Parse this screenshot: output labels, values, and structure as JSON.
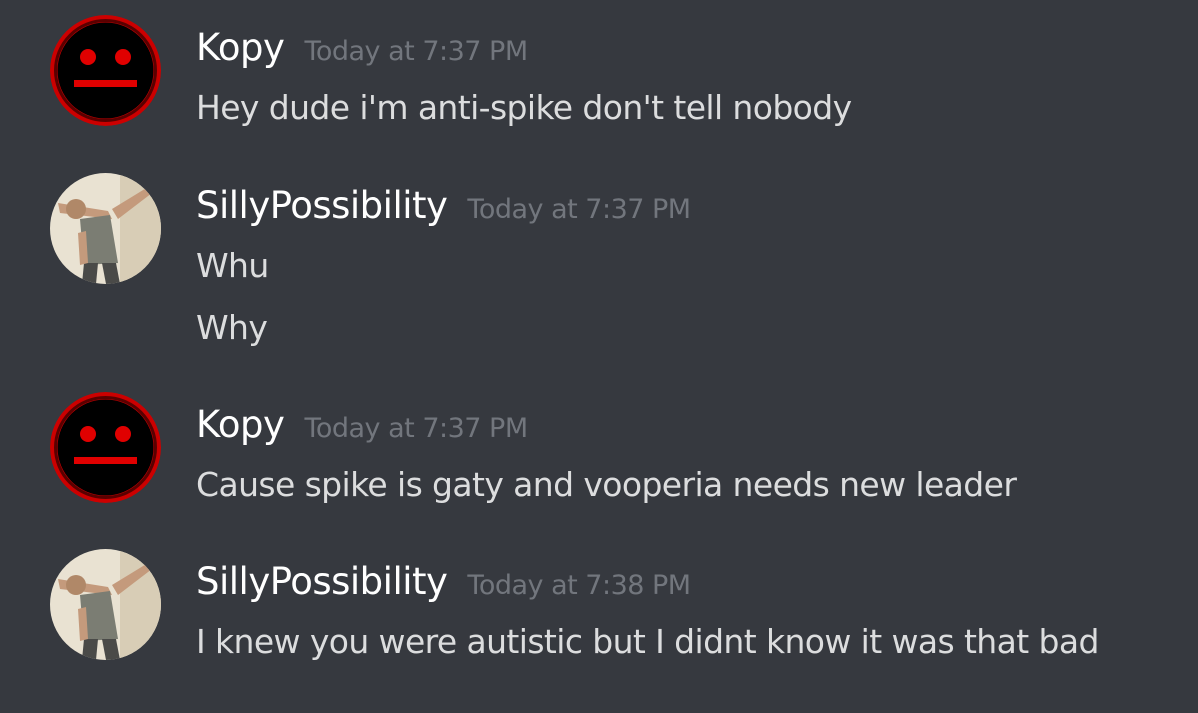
{
  "colors": {
    "background": "#36393f",
    "username": "#ffffff",
    "timestamp": "#72767d",
    "message_text": "#dcddde",
    "kopy_avatar_ring": "#cc0000",
    "kopy_avatar_face": "#000000"
  },
  "messages": [
    {
      "author": "Kopy",
      "timestamp": "Today at 7:37 PM",
      "avatar_icon": "neutral-face-icon",
      "lines": [
        "Hey dude i'm anti-spike don't tell nobody"
      ]
    },
    {
      "author": "SillyPossibility",
      "timestamp": "Today at 7:37 PM",
      "avatar_icon": "dab-photo-avatar",
      "lines": [
        "Whu",
        "Why"
      ]
    },
    {
      "author": "Kopy",
      "timestamp": "Today at 7:37 PM",
      "avatar_icon": "neutral-face-icon",
      "lines": [
        "Cause spike is gaty and vooperia needs new leader"
      ]
    },
    {
      "author": "SillyPossibility",
      "timestamp": "Today at 7:38 PM",
      "avatar_icon": "dab-photo-avatar",
      "lines": [
        "I knew you were autistic but I didnt know it was that bad"
      ]
    }
  ]
}
